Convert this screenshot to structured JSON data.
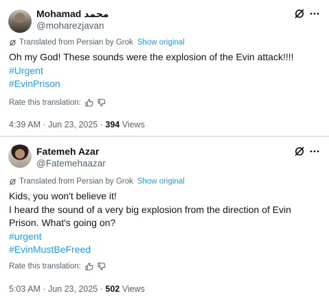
{
  "posts": [
    {
      "display_name": "Mohamad محمد",
      "handle": "@moharezjavan",
      "translated_label": "Translated from Persian by Grok",
      "show_original": "Show original",
      "text_lines": [
        "Oh my God! These sounds were the explosion of the Evin attack!!!!"
      ],
      "hashtags": [
        "#Urgent",
        "#EvinPrison"
      ],
      "rate_label": "Rate this translation:",
      "timestamp": "4:39 AM · Jun 23, 2025 · ",
      "views_count": "394",
      "views_label": " Views"
    },
    {
      "display_name": "Fatemeh Azar",
      "handle": "@Fatemehaazar",
      "translated_label": "Translated from Persian by Grok",
      "show_original": "Show original",
      "text_lines": [
        "Kids, you won't believe it!",
        "I heard the sound of a very big explosion from the direction of Evin",
        "Prison. What's going on?"
      ],
      "hashtags": [
        "#urgent",
        "#EvinMustBeFreed"
      ],
      "rate_label": "Rate this translation:",
      "timestamp": "5:03 AM · Jun 23, 2025 · ",
      "views_count": "502",
      "views_label": " Views"
    }
  ],
  "icons": {
    "grok": "grok-icon",
    "more": "more-icon",
    "thumbs_up": "thumbs-up-icon",
    "thumbs_down": "thumbs-down-icon"
  },
  "colors": {
    "link": "#1d9bf0",
    "secondary_text": "#536471",
    "primary_text": "#0f1419"
  }
}
